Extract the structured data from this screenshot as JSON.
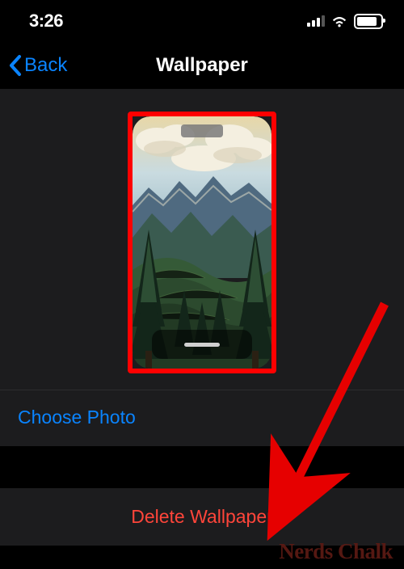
{
  "status": {
    "time": "3:26"
  },
  "nav": {
    "back_label": "Back",
    "title": "Wallpaper"
  },
  "actions": {
    "choose_photo": "Choose Photo",
    "delete": "Delete Wallpaper"
  },
  "watermark": "Nerds Chalk",
  "colors": {
    "ios_blue": "#0a84ff",
    "ios_red": "#ff453a",
    "annotation_red": "#ff0000"
  }
}
